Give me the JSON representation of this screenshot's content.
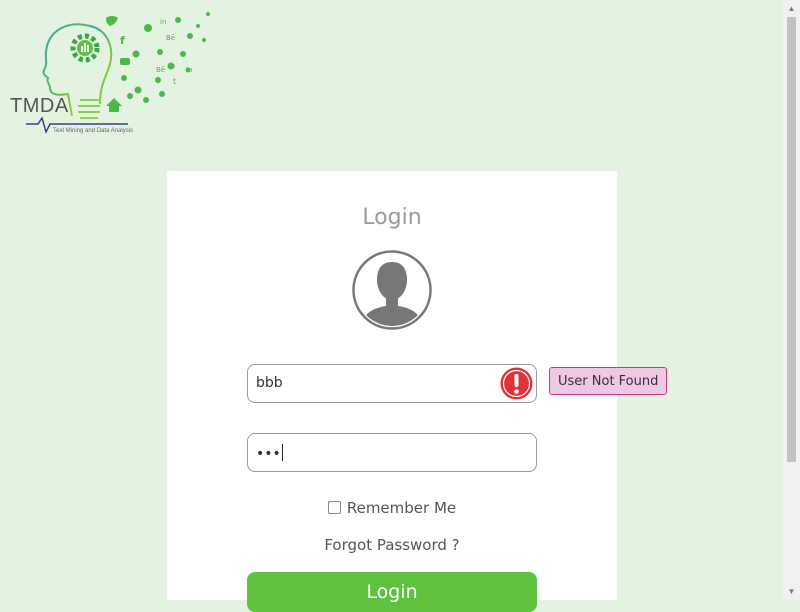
{
  "logo": {
    "name": "TMDA",
    "tagline": "Text Mining and Data Analysis"
  },
  "login": {
    "title": "Login",
    "username_value": "bbb",
    "password_mask": "•••",
    "error_tooltip": "User Not Found",
    "remember_label": "Remember Me",
    "remember_checked": false,
    "forgot_label": "Forgot Password ?",
    "button_label": "Login"
  },
  "icons": {
    "avatar": "user-avatar-icon",
    "error": "exclamation-icon",
    "checkbox": "checkbox-icon"
  },
  "colors": {
    "background": "#e4f3e1",
    "accent": "#5ec23f",
    "error": "#e0323a",
    "tooltip_bg": "#f0c8e3",
    "tooltip_border": "#c9398b"
  }
}
